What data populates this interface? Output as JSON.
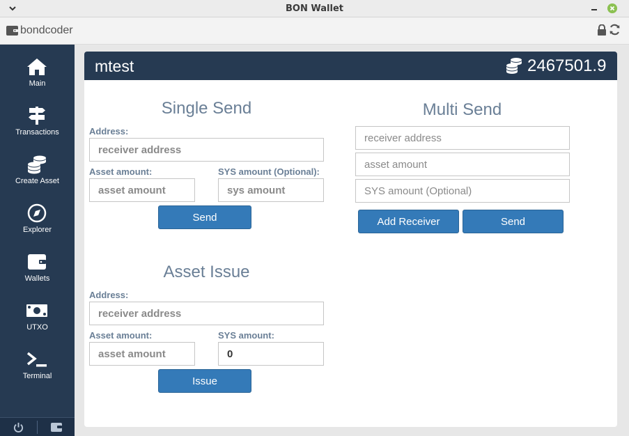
{
  "window": {
    "title": "BON Wallet"
  },
  "header": {
    "username": "bondcoder"
  },
  "sidebar": {
    "items": [
      {
        "label": "Main"
      },
      {
        "label": "Transactions"
      },
      {
        "label": "Create Asset"
      },
      {
        "label": "Explorer"
      },
      {
        "label": "Wallets"
      },
      {
        "label": "UTXO"
      },
      {
        "label": "Terminal"
      }
    ]
  },
  "account": {
    "name": "mtest",
    "balance": "2467501.9"
  },
  "single_send": {
    "title": "Single Send",
    "address_label": "Address:",
    "address_placeholder": "receiver address",
    "asset_label": "Asset amount:",
    "asset_placeholder": "asset amount",
    "sys_label": "SYS amount (Optional):",
    "sys_placeholder": "sys amount",
    "send_label": "Send"
  },
  "asset_issue": {
    "title": "Asset Issue",
    "address_label": "Address:",
    "address_placeholder": "receiver address",
    "asset_label": "Asset amount:",
    "asset_placeholder": "asset amount",
    "sys_label": "SYS amount:",
    "sys_value": "0",
    "issue_label": "Issue"
  },
  "multi_send": {
    "title": "Multi Send",
    "address_placeholder": "receiver address",
    "asset_placeholder": "asset amount",
    "sys_placeholder": "SYS amount (Optional)",
    "add_receiver_label": "Add Receiver",
    "send_label": "Send"
  },
  "colors": {
    "sidebar": "#263a52",
    "button": "#347ab8",
    "label": "#6a7f96"
  }
}
